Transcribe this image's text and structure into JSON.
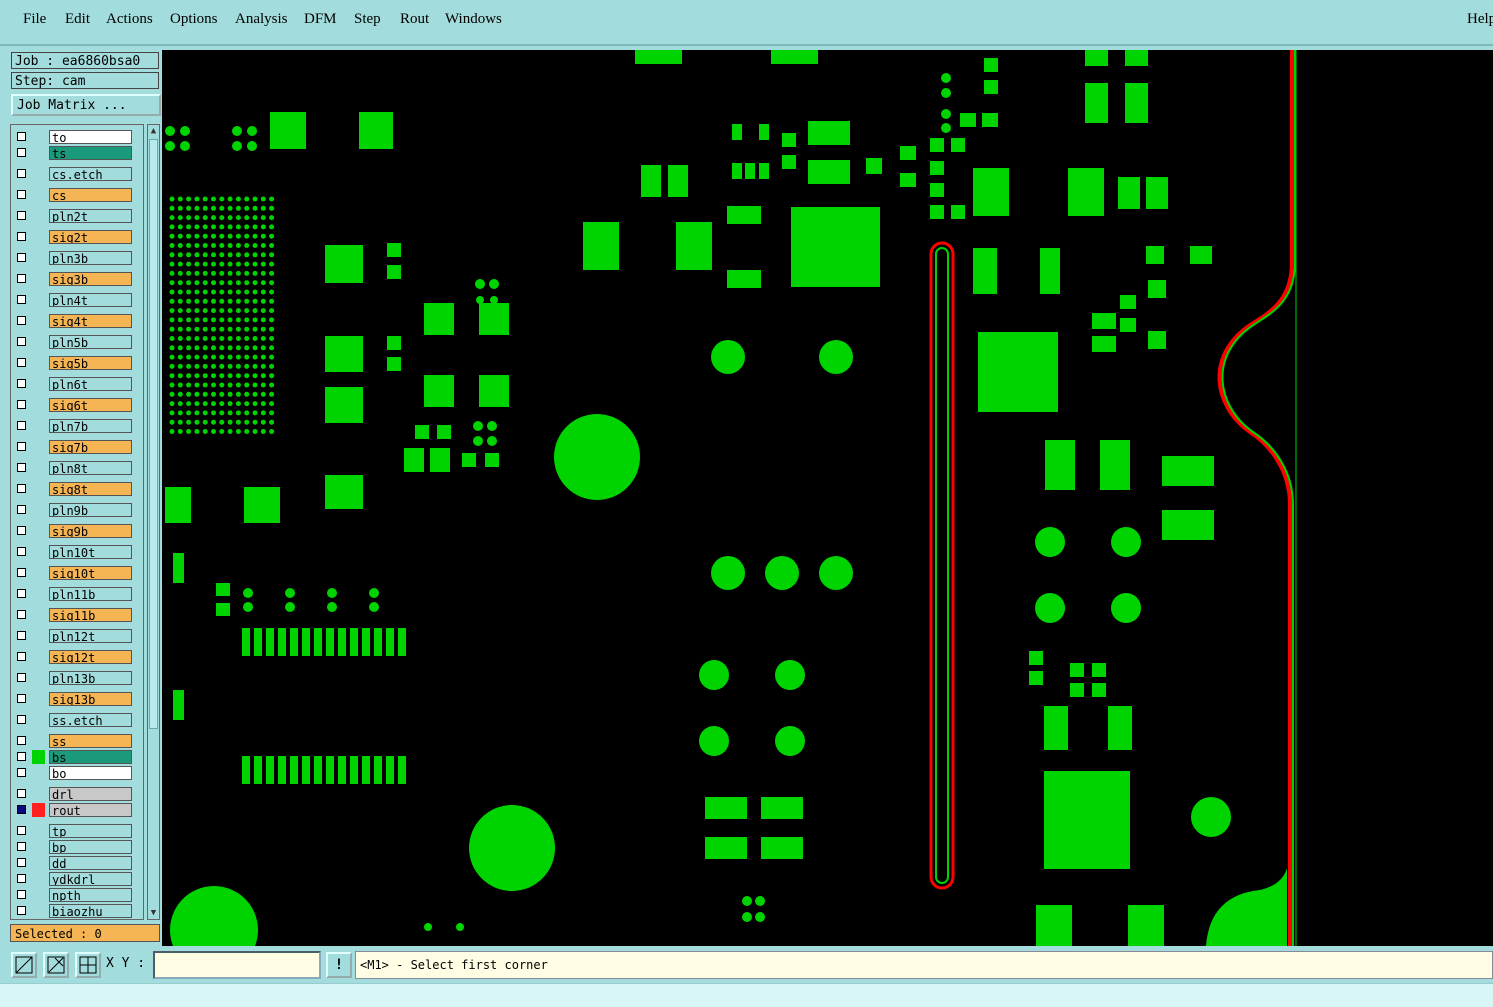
{
  "menu": {
    "items": [
      {
        "label": "File"
      },
      {
        "label": "Edit"
      },
      {
        "label": "Actions"
      },
      {
        "label": "Options"
      },
      {
        "label": "Analysis"
      },
      {
        "label": "DFM"
      },
      {
        "label": "Step"
      },
      {
        "label": "Rout"
      },
      {
        "label": "Windows"
      }
    ],
    "help": "Help"
  },
  "panel": {
    "job": "Job : ea6860bsa0",
    "step": "Step: cam",
    "job_matrix": "Job Matrix ...",
    "selected": "Selected : 0"
  },
  "colors": {
    "white": "#ffffff",
    "teal": "#1a9a7a",
    "cyan": "#a3dcdc",
    "orange": "#f5b555",
    "gray": "#c8c8c8",
    "copper": "#00d400",
    "rout_outline": "#ff0000",
    "rout_active": "#ff2020",
    "drill_active": "#0a0a80"
  },
  "layers": [
    {
      "name": "to",
      "color": "white"
    },
    {
      "name": "ts",
      "color": "teal"
    },
    {
      "name": "cs.etch",
      "color": "cyan"
    },
    {
      "name": "cs",
      "color": "orange"
    },
    {
      "name": "pln2t",
      "color": "cyan"
    },
    {
      "name": "sig2t",
      "color": "orange"
    },
    {
      "name": "pln3b",
      "color": "cyan"
    },
    {
      "name": "sig3b",
      "color": "orange"
    },
    {
      "name": "pln4t",
      "color": "cyan"
    },
    {
      "name": "sig4t",
      "color": "orange"
    },
    {
      "name": "pln5b",
      "color": "cyan"
    },
    {
      "name": "sig5b",
      "color": "orange"
    },
    {
      "name": "pln6t",
      "color": "cyan"
    },
    {
      "name": "sig6t",
      "color": "orange"
    },
    {
      "name": "pln7b",
      "color": "cyan"
    },
    {
      "name": "sig7b",
      "color": "orange"
    },
    {
      "name": "pln8t",
      "color": "cyan"
    },
    {
      "name": "sig8t",
      "color": "orange"
    },
    {
      "name": "pln9b",
      "color": "cyan"
    },
    {
      "name": "sig9b",
      "color": "orange"
    },
    {
      "name": "pln10t",
      "color": "cyan"
    },
    {
      "name": "sig10t",
      "color": "orange"
    },
    {
      "name": "pln11b",
      "color": "cyan"
    },
    {
      "name": "sig11b",
      "color": "orange"
    },
    {
      "name": "pln12t",
      "color": "cyan"
    },
    {
      "name": "sig12t",
      "color": "orange"
    },
    {
      "name": "pln13b",
      "color": "cyan"
    },
    {
      "name": "sig13b",
      "color": "orange"
    },
    {
      "name": "ss.etch",
      "color": "cyan"
    },
    {
      "name": "ss",
      "color": "orange"
    },
    {
      "name": "bs",
      "color": "teal",
      "active_color": "copper"
    },
    {
      "name": "bo",
      "color": "white"
    },
    {
      "name": "drl",
      "color": "gray"
    },
    {
      "name": "rout",
      "color": "gray",
      "active_color": "rout_active",
      "checked": true,
      "sub": "⊞"
    },
    {
      "name": "tp",
      "color": "cyan"
    },
    {
      "name": "bp",
      "color": "cyan"
    },
    {
      "name": "dd",
      "color": "cyan"
    },
    {
      "name": "ydkdrl",
      "color": "cyan"
    },
    {
      "name": "npth",
      "color": "cyan"
    },
    {
      "name": "biaozhu",
      "color": "cyan"
    }
  ],
  "bottom": {
    "xy_label": "X Y :",
    "xy_value": "",
    "exclaim": "!",
    "status": "<M1> - Select first corner"
  }
}
